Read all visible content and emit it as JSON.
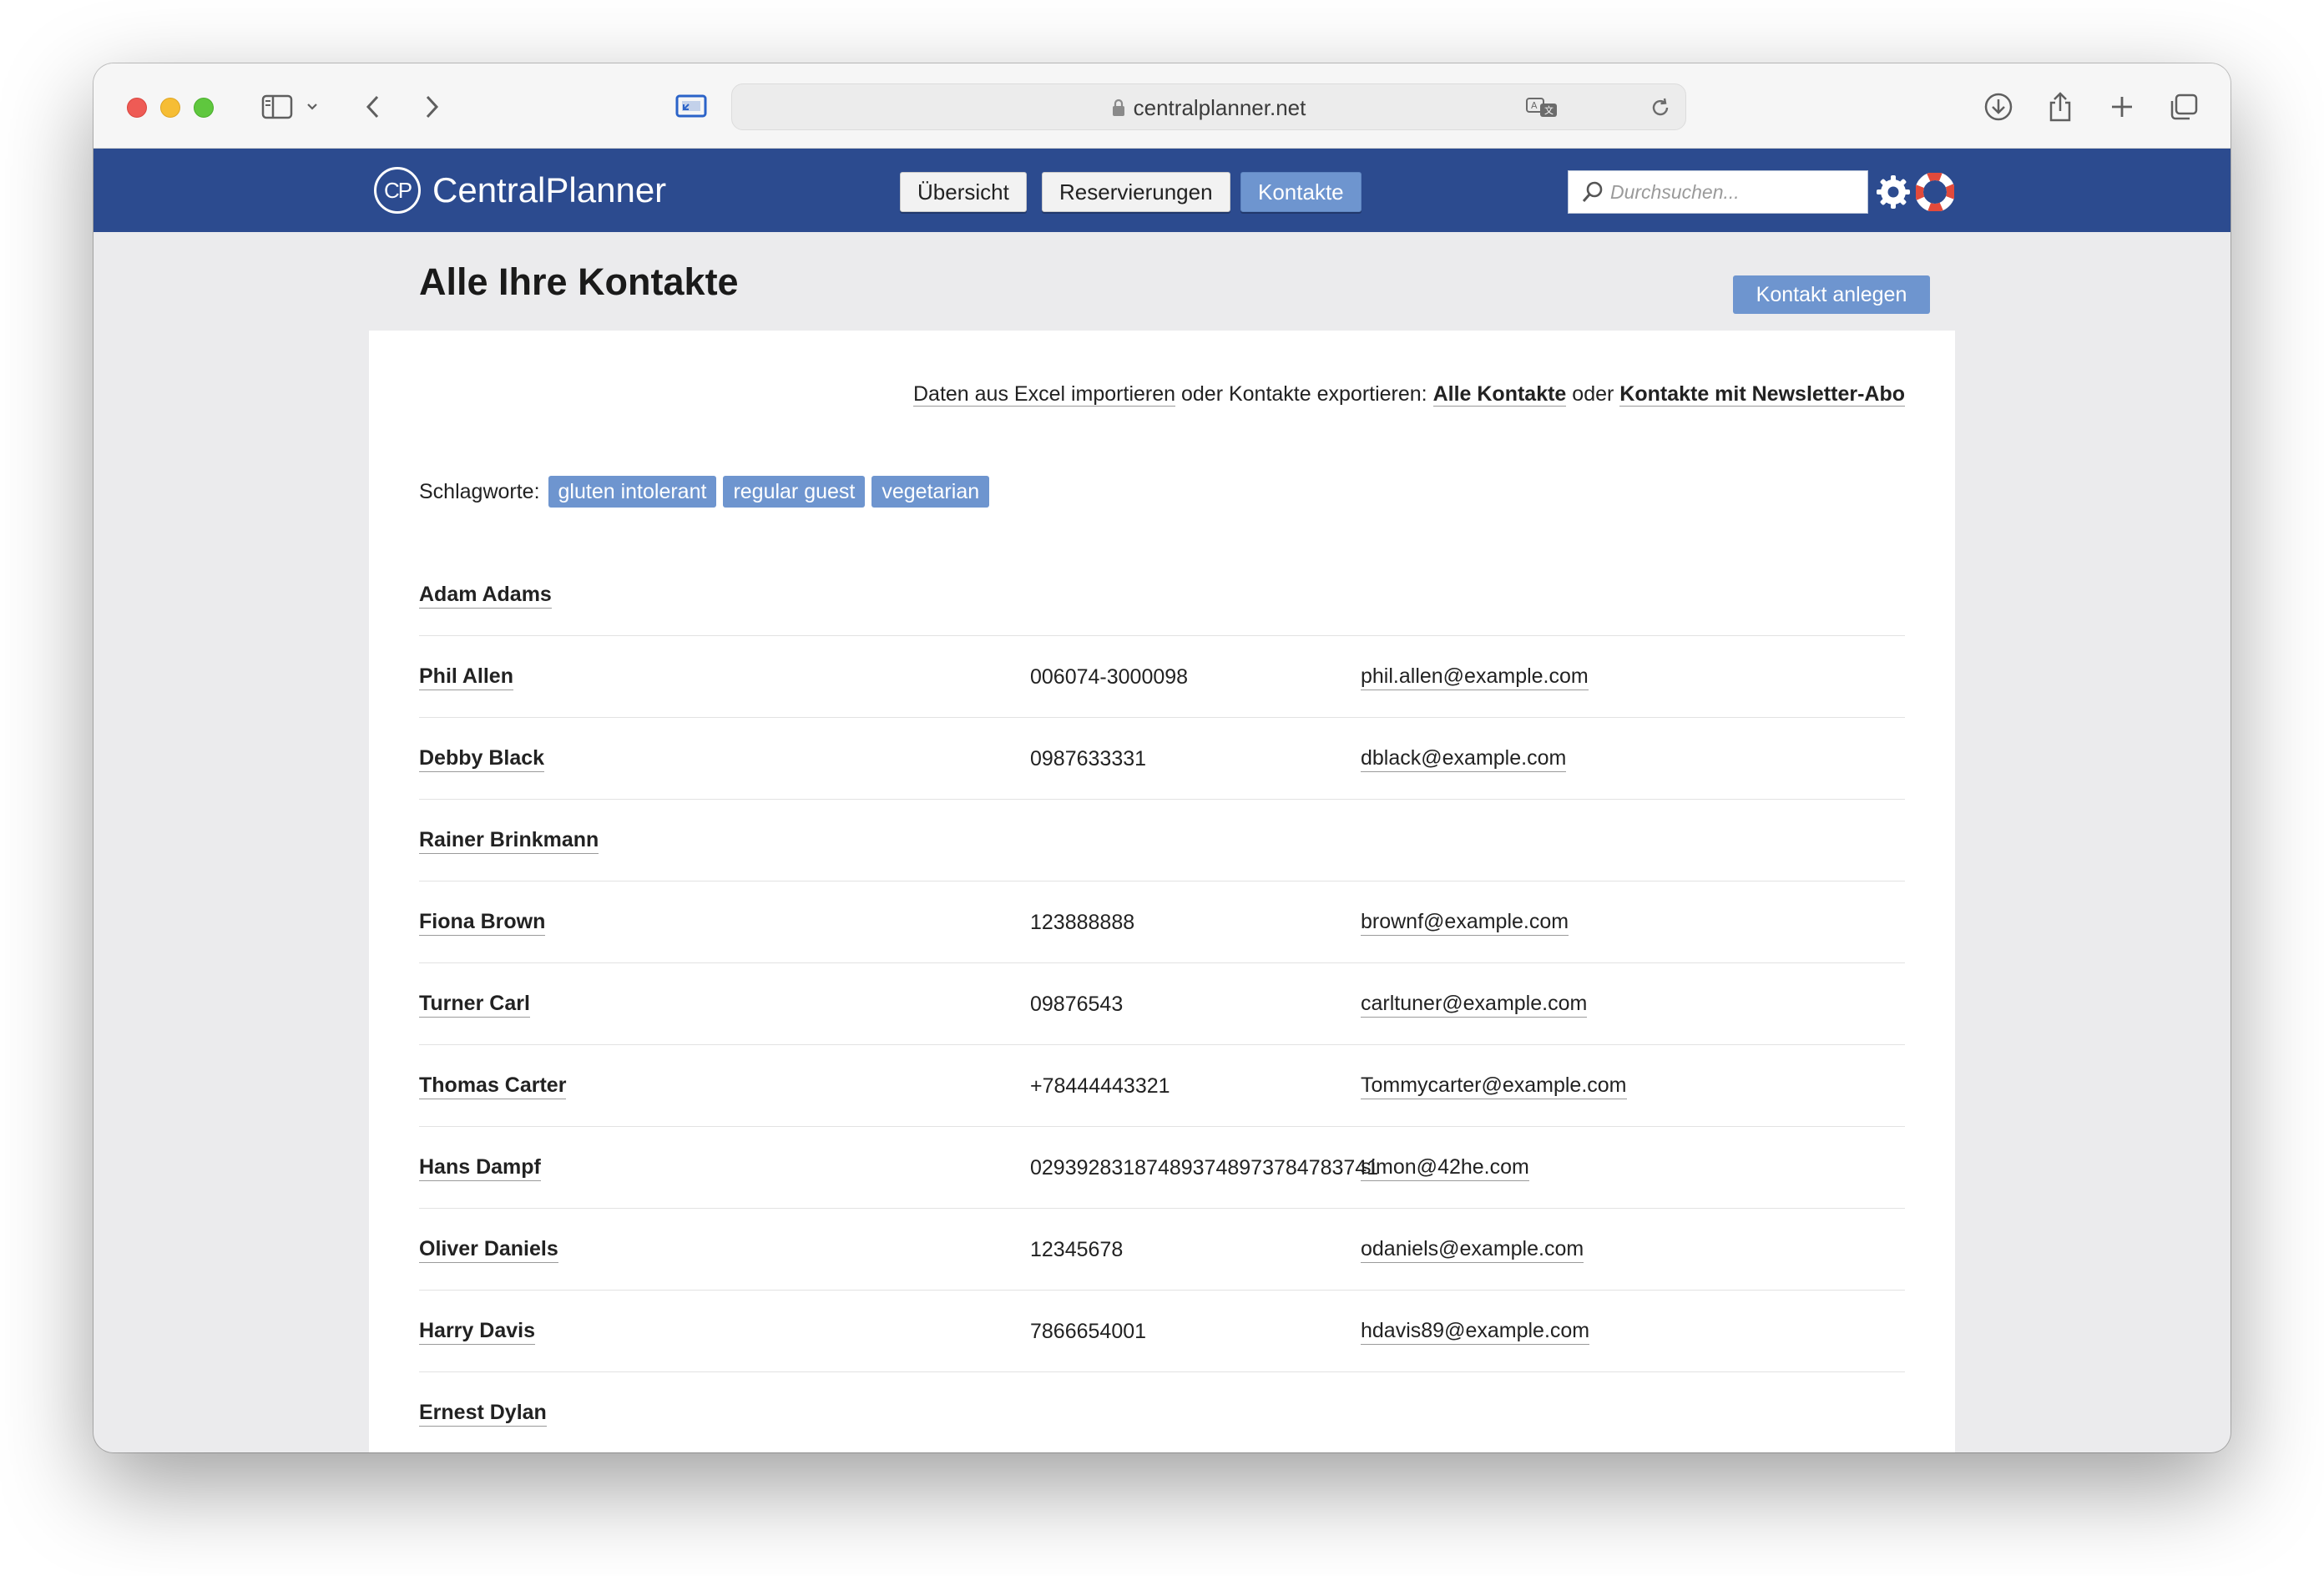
{
  "browser": {
    "url": "centralplanner.net"
  },
  "app": {
    "brand": "CentralPlanner",
    "logo_mark": "CP",
    "nav": [
      {
        "label": "Übersicht"
      },
      {
        "label": "Reservierungen"
      },
      {
        "label": "Kontakte",
        "active": true
      }
    ],
    "search": {
      "placeholder": "Durchsuchen..."
    }
  },
  "page": {
    "title": "Alle Ihre Kontakte",
    "create_button": "Kontakt anlegen",
    "export": {
      "import_link": "Daten aus Excel importieren",
      "text_1": " oder Kontakte exportieren: ",
      "all_link": "Alle Kontakte",
      "text_2": " oder ",
      "newsletter_link": "Kontakte mit Newsletter-Abo"
    },
    "tags": {
      "label": "Schlagworte:",
      "items": [
        "gluten intolerant",
        "regular guest",
        "vegetarian"
      ]
    },
    "contacts": [
      {
        "name": "Adam Adams",
        "phone": "",
        "email": ""
      },
      {
        "name": "Phil Allen",
        "phone": "006074-3000098",
        "email": "phil.allen@example.com"
      },
      {
        "name": "Debby Black",
        "phone": "0987633331",
        "email": "dblack@example.com"
      },
      {
        "name": "Rainer Brinkmann",
        "phone": "",
        "email": ""
      },
      {
        "name": "Fiona Brown",
        "phone": "123888888",
        "email": "brownf@example.com"
      },
      {
        "name": "Turner Carl",
        "phone": "09876543",
        "email": "carltuner@example.com"
      },
      {
        "name": "Thomas Carter",
        "phone": "+78444443321",
        "email": "Tommycarter@example.com"
      },
      {
        "name": "Hans Dampf",
        "phone": "029392831874893748973784783741",
        "email": "simon@42he.com"
      },
      {
        "name": "Oliver Daniels",
        "phone": "12345678",
        "email": "odaniels@example.com"
      },
      {
        "name": "Harry Davis",
        "phone": "7866654001",
        "email": "hdavis89@example.com"
      },
      {
        "name": "Ernest Dylan",
        "phone": "",
        "email": ""
      }
    ]
  },
  "colors": {
    "header_bg": "#2c4b8f",
    "accent": "#6e95cf",
    "page_bg": "#ebebed"
  },
  "icons": [
    "sidebar-icon",
    "chevron-down-icon",
    "back-icon",
    "forward-icon",
    "screen-share-icon",
    "lock-icon",
    "translate-icon",
    "reload-icon",
    "download-icon",
    "share-icon",
    "new-tab-icon",
    "tabs-overview-icon",
    "search-icon",
    "gear-icon",
    "help-lifebuoy-icon"
  ]
}
